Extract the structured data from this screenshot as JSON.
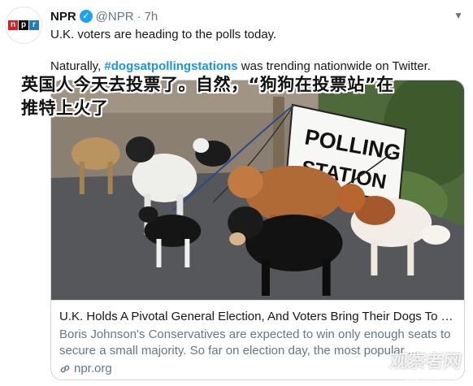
{
  "account": {
    "name": "NPR",
    "handle": "@NPR",
    "separator": "·",
    "time": "7h",
    "logo_letters": [
      "n",
      "p",
      "r"
    ]
  },
  "tweet": {
    "line1": "U.K. voters are heading to the polls today.",
    "line2_prefix": "Naturally, ",
    "hashtag": "#dogsatpollingstations",
    "line2_suffix": " was trending nationwide on Twitter."
  },
  "overlay": {
    "line1": "英国人今天去投票了。自然，“狗狗在投票站”在",
    "line2": "推特上火了"
  },
  "photo": {
    "sign_line1": "POLLING",
    "sign_line2": "STATION"
  },
  "card": {
    "title": "U.K. Holds A Pivotal General Election, And Voters Bring Their Dogs To T...",
    "description": "Boris Johnson's Conservatives are expected to win only enough seats to secure a small majority. So far on election day, the most popular ...",
    "domain": "npr.org"
  },
  "watermark": {
    "text": "观察者网",
    "sub": "www.guancha.cn"
  },
  "colors": {
    "link": "#1b95e0",
    "verified": "#1da1f2",
    "muted": "#657786"
  }
}
